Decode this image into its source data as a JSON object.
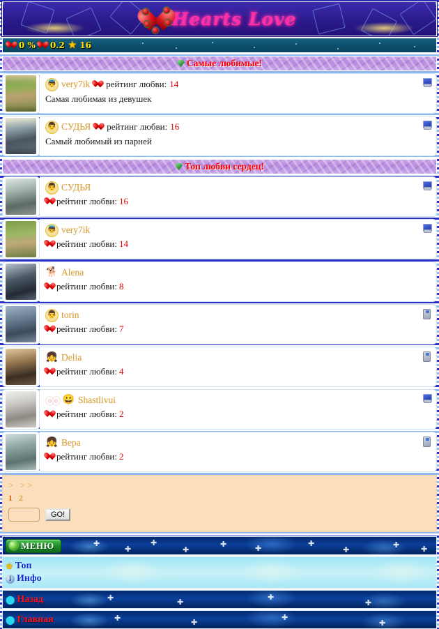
{
  "site": {
    "logo_text": "Hearts Love",
    "logo_icon": "heart-roses-icon"
  },
  "statusbar": {
    "percent_icon": "heart-icon",
    "percent_value": "0 %",
    "hearts_icon": "heart-icon",
    "hearts_value": "0.2",
    "star_icon": "star-icon",
    "star_value": "16"
  },
  "sections": [
    {
      "icon": "gem-icon",
      "title": "Самые любимые!",
      "rows": [
        {
          "username": "very7ik",
          "avatar_icon": "angel-avatar-icon",
          "avatar_glyph": "👼",
          "rating_label": "рейтинг любви:",
          "rating_value": "14",
          "description": "Самая любимая из девушек",
          "device_icon": "desktop-icon",
          "inline_heart": true
        },
        {
          "username": "СУДЬЯ",
          "avatar_icon": "man-avatar-icon",
          "avatar_glyph": "👨",
          "rating_label": "рейтинг любви:",
          "rating_value": "16",
          "description": "Самый любимый из парней",
          "device_icon": "desktop-icon",
          "inline_heart": true
        }
      ]
    },
    {
      "icon": "gem-icon",
      "title": "Топ любви сердец!",
      "rows": [
        {
          "username": "СУДЬЯ",
          "avatar_icon": "man-avatar-icon",
          "avatar_glyph": "👨",
          "rating_label": "рейтинг любви:",
          "rating_value": "16",
          "device_icon": "desktop-icon",
          "badge": ""
        },
        {
          "username": "very7ik",
          "avatar_icon": "angel-avatar-icon",
          "avatar_glyph": "👼",
          "rating_label": "рейтинг любви:",
          "rating_value": "14",
          "device_icon": "desktop-icon",
          "badge": ""
        },
        {
          "username": "Alena",
          "avatar_icon": "dog-avatar-icon",
          "avatar_glyph": "🐕",
          "rating_label": "рейтинг любви:",
          "rating_value": "8",
          "device_icon": "none",
          "badge": ""
        },
        {
          "username": "torin",
          "avatar_icon": "man-avatar-icon",
          "avatar_glyph": "👨",
          "rating_label": "рейтинг любви:",
          "rating_value": "7",
          "device_icon": "phone-icon",
          "badge": ""
        },
        {
          "username": "Delia",
          "avatar_icon": "girl-avatar-icon",
          "avatar_glyph": "👧",
          "rating_label": "рейтинг любви:",
          "rating_value": "4",
          "device_icon": "phone-icon",
          "badge": ""
        },
        {
          "username": "Shastlivui",
          "avatar_icon": "smiley-avatar-icon",
          "avatar_glyph": "😀",
          "rating_label": "рейтинг любви:",
          "rating_value": "2",
          "device_icon": "desktop-icon",
          "badge": "ⓞⓞ"
        },
        {
          "username": "Вера",
          "avatar_icon": "girl-avatar-icon",
          "avatar_glyph": "👧",
          "rating_label": "рейтинг любви:",
          "rating_value": "2",
          "device_icon": "phone-icon",
          "badge": ""
        }
      ]
    }
  ],
  "pager": {
    "arrows": "> >>",
    "pages": [
      "1",
      "2"
    ],
    "input_value": "",
    "go_label": "GO!"
  },
  "footer": {
    "menu_label": "МЕНЮ",
    "links": [
      {
        "label": "Топ",
        "icon": "crown-icon"
      },
      {
        "label": "Инфо",
        "icon": "info-icon"
      },
      {
        "label": "Назад",
        "icon": "arrow-left-icon"
      },
      {
        "label": "Главная",
        "icon": "arrow-left-icon"
      }
    ]
  }
}
